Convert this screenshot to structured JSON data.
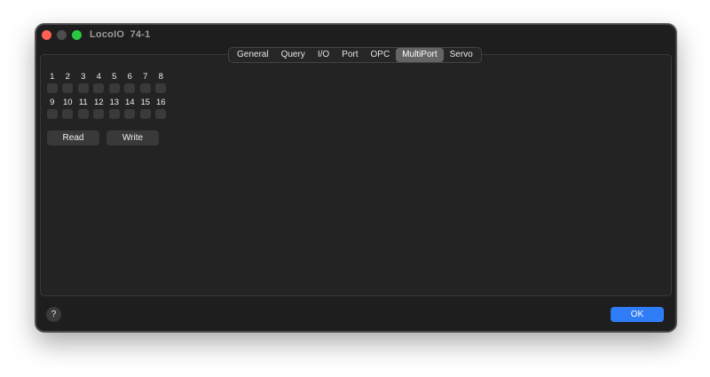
{
  "window": {
    "title": "LocoIO  74-1"
  },
  "tabs": [
    {
      "label": "General",
      "active": false
    },
    {
      "label": "Query",
      "active": false
    },
    {
      "label": "I/O",
      "active": false
    },
    {
      "label": "Port",
      "active": false
    },
    {
      "label": "OPC",
      "active": false
    },
    {
      "label": "MultiPort",
      "active": true
    },
    {
      "label": "Servo",
      "active": false
    }
  ],
  "multiport": {
    "row1": [
      "1",
      "2",
      "3",
      "4",
      "5",
      "6",
      "7",
      "8"
    ],
    "row2": [
      "9",
      "10",
      "11",
      "12",
      "13",
      "14",
      "15",
      "16"
    ],
    "read_label": "Read",
    "write_label": "Write"
  },
  "footer": {
    "help_label": "?",
    "ok_label": "OK"
  },
  "colors": {
    "accent": "#2f7df6",
    "close": "#fe5f57",
    "zoom": "#29c740"
  }
}
